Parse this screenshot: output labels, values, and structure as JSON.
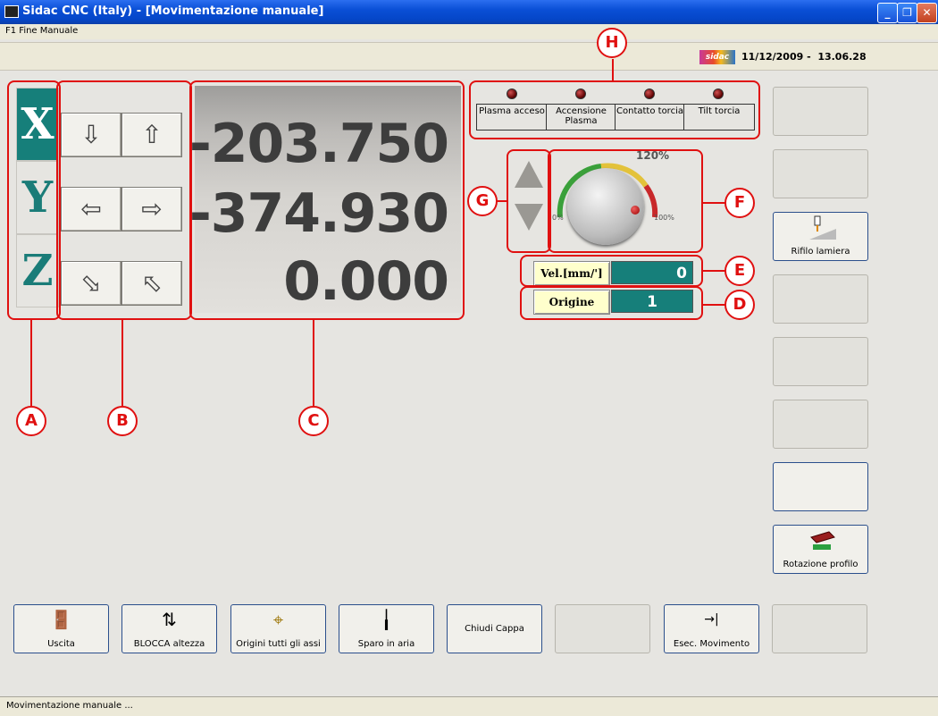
{
  "window": {
    "title": "Sidac CNC (Italy) - [Movimentazione manuale]",
    "minimize_glyph": "_",
    "restore_glyph": "❐",
    "close_glyph": "✕"
  },
  "menu": {
    "item": "F1 Fine Manuale"
  },
  "header": {
    "logo_text": "sidac",
    "datetime": "11/12/2009 -  13.06.28"
  },
  "axes": [
    {
      "label": "X",
      "active": true
    },
    {
      "label": "Y",
      "active": false
    },
    {
      "label": "Z",
      "active": false
    }
  ],
  "jog_buttons": {
    "x_minus": "⇩",
    "x_plus": "⇧",
    "y_minus": "⇦",
    "y_plus": "⇨",
    "z_down": "⬂",
    "z_up": "⬁"
  },
  "coordinates": {
    "x": "-203.750",
    "y": "-374.930",
    "z": "0.000"
  },
  "status_lights": [
    {
      "label": "Plasma acceso"
    },
    {
      "label": "Accensione Plasma"
    },
    {
      "label": "Contatto torcia"
    },
    {
      "label": "Tilt torcia"
    }
  ],
  "override": {
    "max_label": "120%",
    "min_label": "0%",
    "nominal_label": "100%"
  },
  "speed": {
    "label": "Vel.[mm/']",
    "value": "0"
  },
  "origin": {
    "label": "Origine",
    "value": "1"
  },
  "side_buttons": [
    {
      "label": ""
    },
    {
      "label": ""
    },
    {
      "label": "Rifilo lamiera"
    },
    {
      "label": ""
    },
    {
      "label": ""
    },
    {
      "label": ""
    },
    {
      "label": ""
    },
    {
      "label": "Rotazione profilo"
    }
  ],
  "bottom_buttons": [
    {
      "label": "Uscita",
      "icon": "exit-door-icon",
      "glyph": "🚪"
    },
    {
      "label": "BLOCCA altezza",
      "icon": "torch-height-lock-icon",
      "glyph": "⇅"
    },
    {
      "label": "Origini tutti gli assi",
      "icon": "axes-origin-icon",
      "glyph": "⌖"
    },
    {
      "label": "Sparo in aria",
      "icon": "torch-fire-icon",
      "glyph": "╽"
    },
    {
      "label": "Chiudi Cappa",
      "icon": "",
      "glyph": ""
    },
    {
      "label": "",
      "icon": "",
      "glyph": ""
    },
    {
      "label": "Esec. Movimento",
      "icon": "move-execute-icon",
      "glyph": "→|"
    },
    {
      "label": "",
      "icon": "",
      "glyph": ""
    }
  ],
  "status_bar": {
    "text": "Movimentazione manuale ..."
  },
  "callouts": [
    "A",
    "B",
    "C",
    "D",
    "E",
    "F",
    "G",
    "H"
  ],
  "colors": {
    "accent": "#167f7a",
    "callout": "#e01010",
    "titlebar": "#0a4fd6"
  }
}
